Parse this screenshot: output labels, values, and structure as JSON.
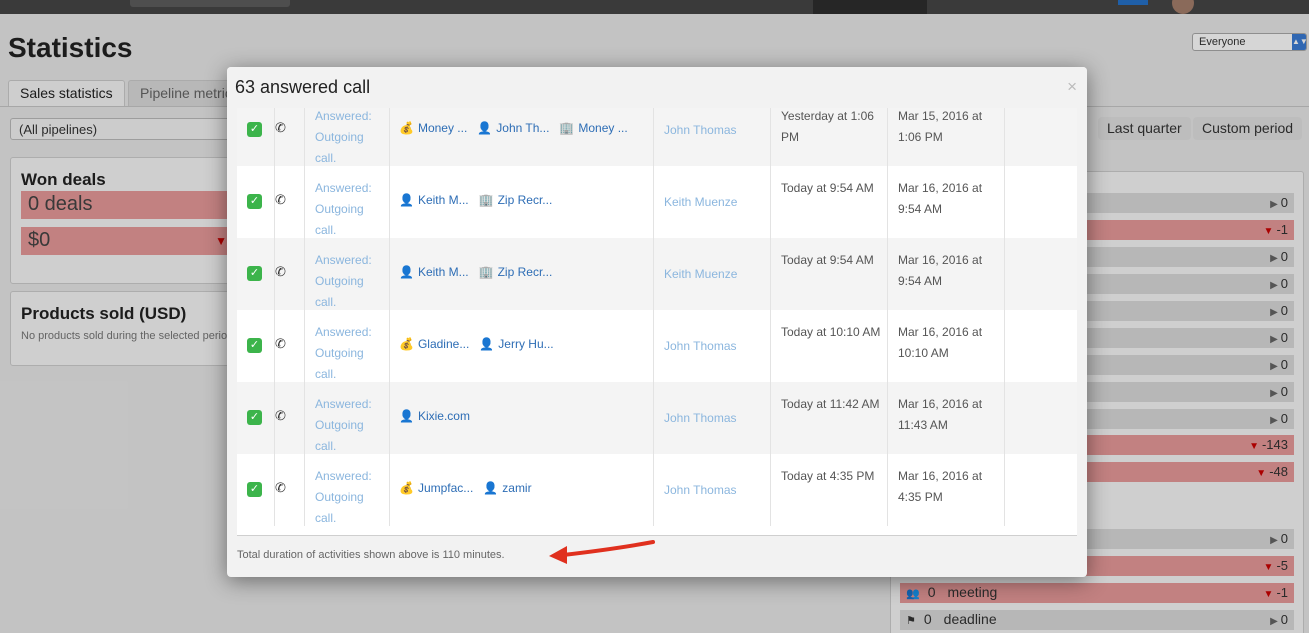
{
  "page": {
    "title": "Statistics",
    "owner_select": "Everyone",
    "tabs": [
      {
        "label": "Sales statistics"
      },
      {
        "label": "Pipeline metrics"
      }
    ],
    "pipeline_select": "(All pipelines)",
    "periods": [
      {
        "label": "Last quarter"
      },
      {
        "label": "Custom period"
      }
    ],
    "won_deals": {
      "title": "Won deals",
      "count": "0 deals",
      "amount": "$0"
    },
    "products_sold": {
      "title": "Products sold (USD)",
      "note": "No products sold during the selected period"
    },
    "stat_values": [
      "0",
      "-1",
      "0",
      "0",
      "0",
      "0",
      "0",
      "0",
      "-143",
      "-48",
      "0",
      "-5"
    ],
    "meeting_row": {
      "count": "0",
      "label": "meeting",
      "value": "-1"
    },
    "deadline_row": {
      "count": "0",
      "label": "deadline",
      "value": "0"
    }
  },
  "modal": {
    "title": "63 answered call",
    "close": "×",
    "footer": "Total duration of activities shown above is 110 minutes.",
    "rows": [
      {
        "subject": "Answered: Outgoing call.",
        "links": [
          {
            "icon": "money",
            "text": "Money ..."
          },
          {
            "icon": "person",
            "text": "John Th..."
          },
          {
            "icon": "org",
            "text": "Money ..."
          }
        ],
        "owner": "John Thomas",
        "due": "Yesterday at 1:06 PM",
        "done": "Mar 15, 2016 at 1:06 PM"
      },
      {
        "subject": "Answered: Outgoing call.",
        "links": [
          {
            "icon": "person",
            "text": "Keith M..."
          },
          {
            "icon": "org",
            "text": "Zip Recr..."
          }
        ],
        "owner": "Keith Muenze",
        "due": "Today at 9:54 AM",
        "done": "Mar 16, 2016 at 9:54 AM"
      },
      {
        "subject": "Answered: Outgoing call.",
        "links": [
          {
            "icon": "person",
            "text": "Keith M..."
          },
          {
            "icon": "org",
            "text": "Zip Recr..."
          }
        ],
        "owner": "Keith Muenze",
        "due": "Today at 9:54 AM",
        "done": "Mar 16, 2016 at 9:54 AM"
      },
      {
        "subject": "Answered: Outgoing call.",
        "links": [
          {
            "icon": "money",
            "text": "Gladine..."
          },
          {
            "icon": "person",
            "text": "Jerry Hu..."
          }
        ],
        "owner": "John Thomas",
        "due": "Today at 10:10 AM",
        "done": "Mar 16, 2016 at 10:10 AM"
      },
      {
        "subject": "Answered: Outgoing call.",
        "links": [
          {
            "icon": "person",
            "text": "Kixie.com"
          }
        ],
        "owner": "John Thomas",
        "due": "Today at 11:42 AM",
        "done": "Mar 16, 2016 at 11:43 AM"
      },
      {
        "subject": "Answered: Outgoing call.",
        "links": [
          {
            "icon": "money",
            "text": "Jumpfac..."
          },
          {
            "icon": "person",
            "text": "zamir"
          }
        ],
        "owner": "John Thomas",
        "due": "Today at 4:35 PM",
        "done": "Mar 16, 2016 at 4:35 PM"
      }
    ]
  }
}
